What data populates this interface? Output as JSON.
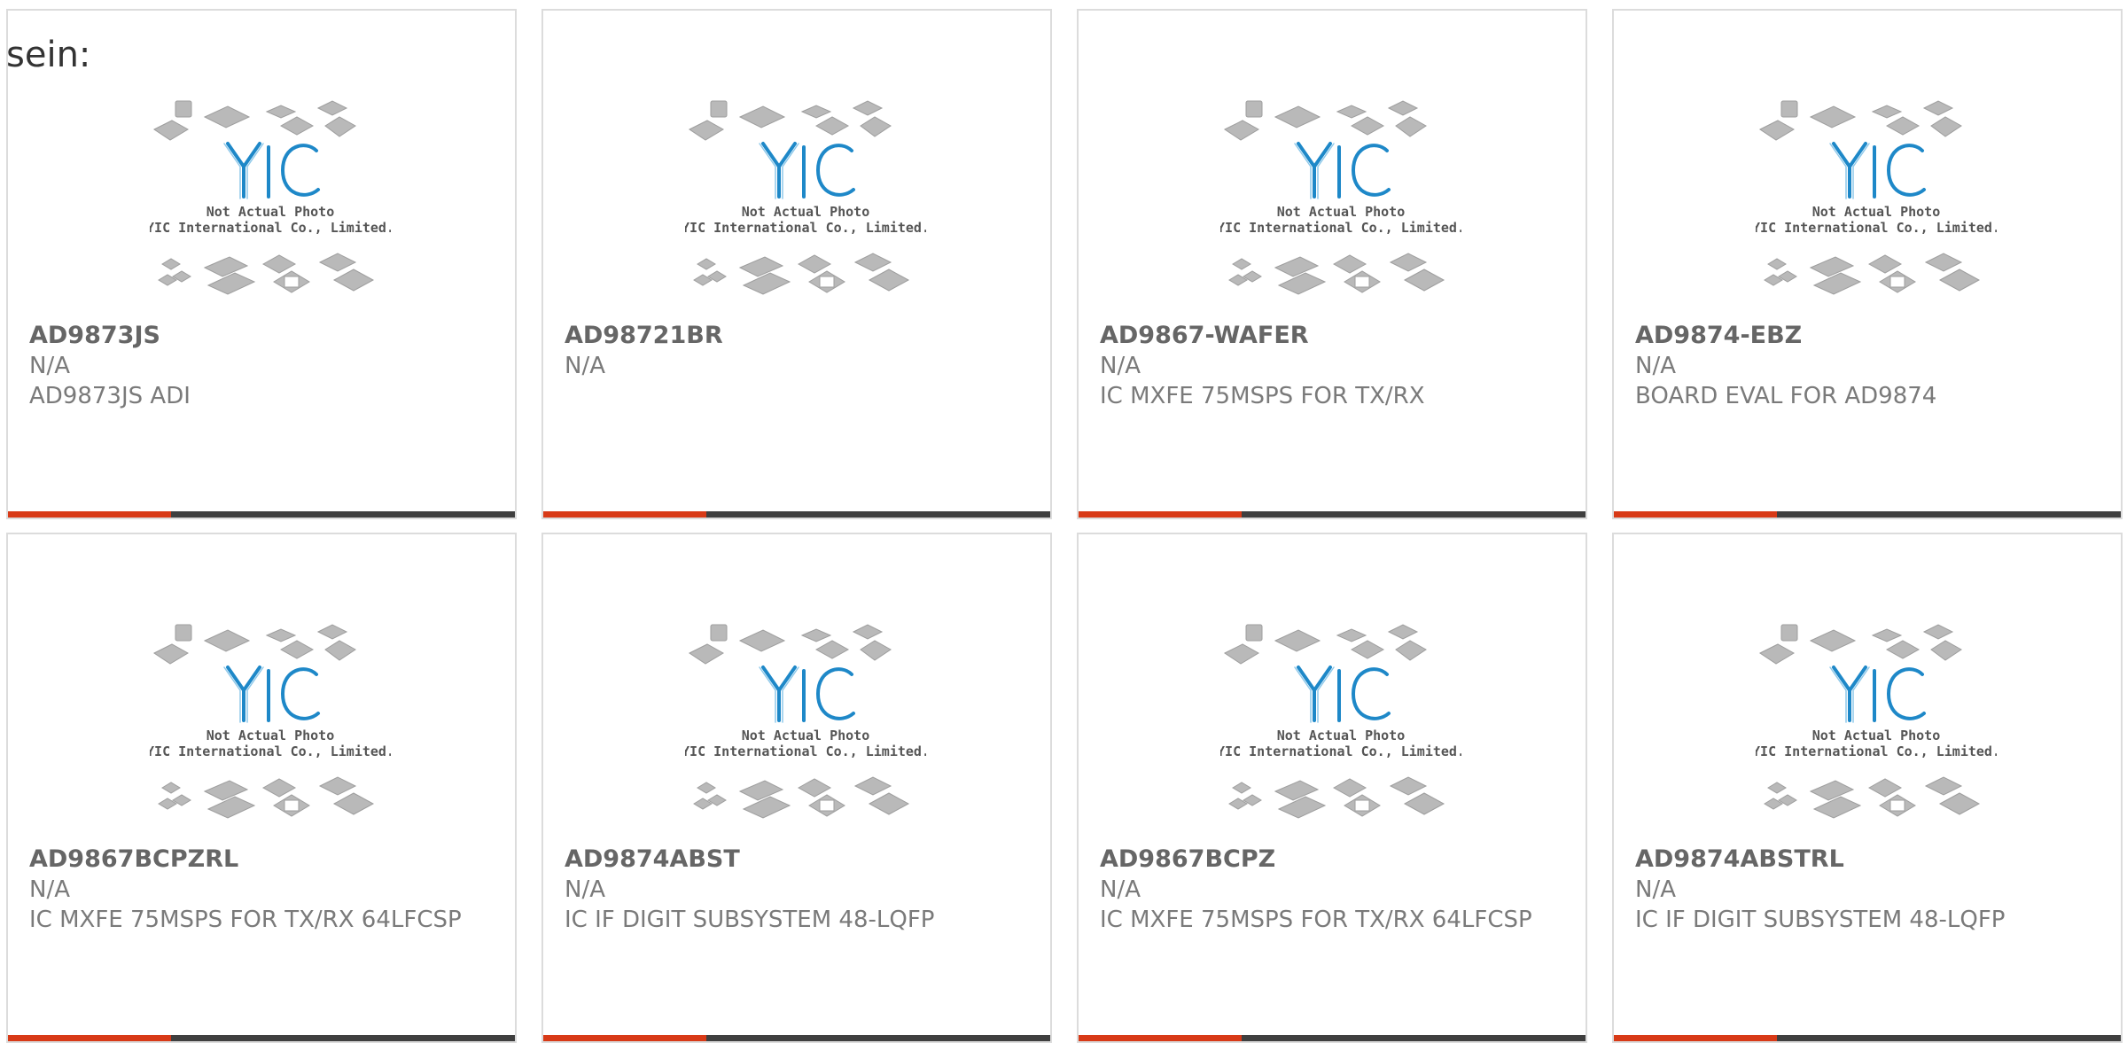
{
  "intro_text": "sein:",
  "image_caption": {
    "line1": "Not Actual Photo",
    "line2": "YIC International Co., Limited.",
    "logo_text": "YIC"
  },
  "colors": {
    "accent": "#d83a17",
    "bar": "#3f3f3f",
    "logo": "#1e88c8",
    "border": "#dcdcdc"
  },
  "products": [
    {
      "part": "AD9873JS",
      "status": "N/A",
      "desc": "AD9873JS ADI"
    },
    {
      "part": "AD98721BR",
      "status": "N/A",
      "desc": ""
    },
    {
      "part": "AD9867-WAFER",
      "status": "N/A",
      "desc": "IC MXFE 75MSPS FOR TX/RX"
    },
    {
      "part": "AD9874-EBZ",
      "status": "N/A",
      "desc": "BOARD EVAL FOR AD9874"
    },
    {
      "part": "AD9867BCPZRL",
      "status": "N/A",
      "desc": "IC MXFE 75MSPS FOR TX/RX 64LFCSP"
    },
    {
      "part": "AD9874ABST",
      "status": "N/A",
      "desc": "IC IF DIGIT SUBSYSTEM 48-LQFP"
    },
    {
      "part": "AD9867BCPZ",
      "status": "N/A",
      "desc": "IC MXFE 75MSPS FOR TX/RX 64LFCSP"
    },
    {
      "part": "AD9874ABSTRL",
      "status": "N/A",
      "desc": "IC IF DIGIT SUBSYSTEM 48-LQFP"
    }
  ]
}
